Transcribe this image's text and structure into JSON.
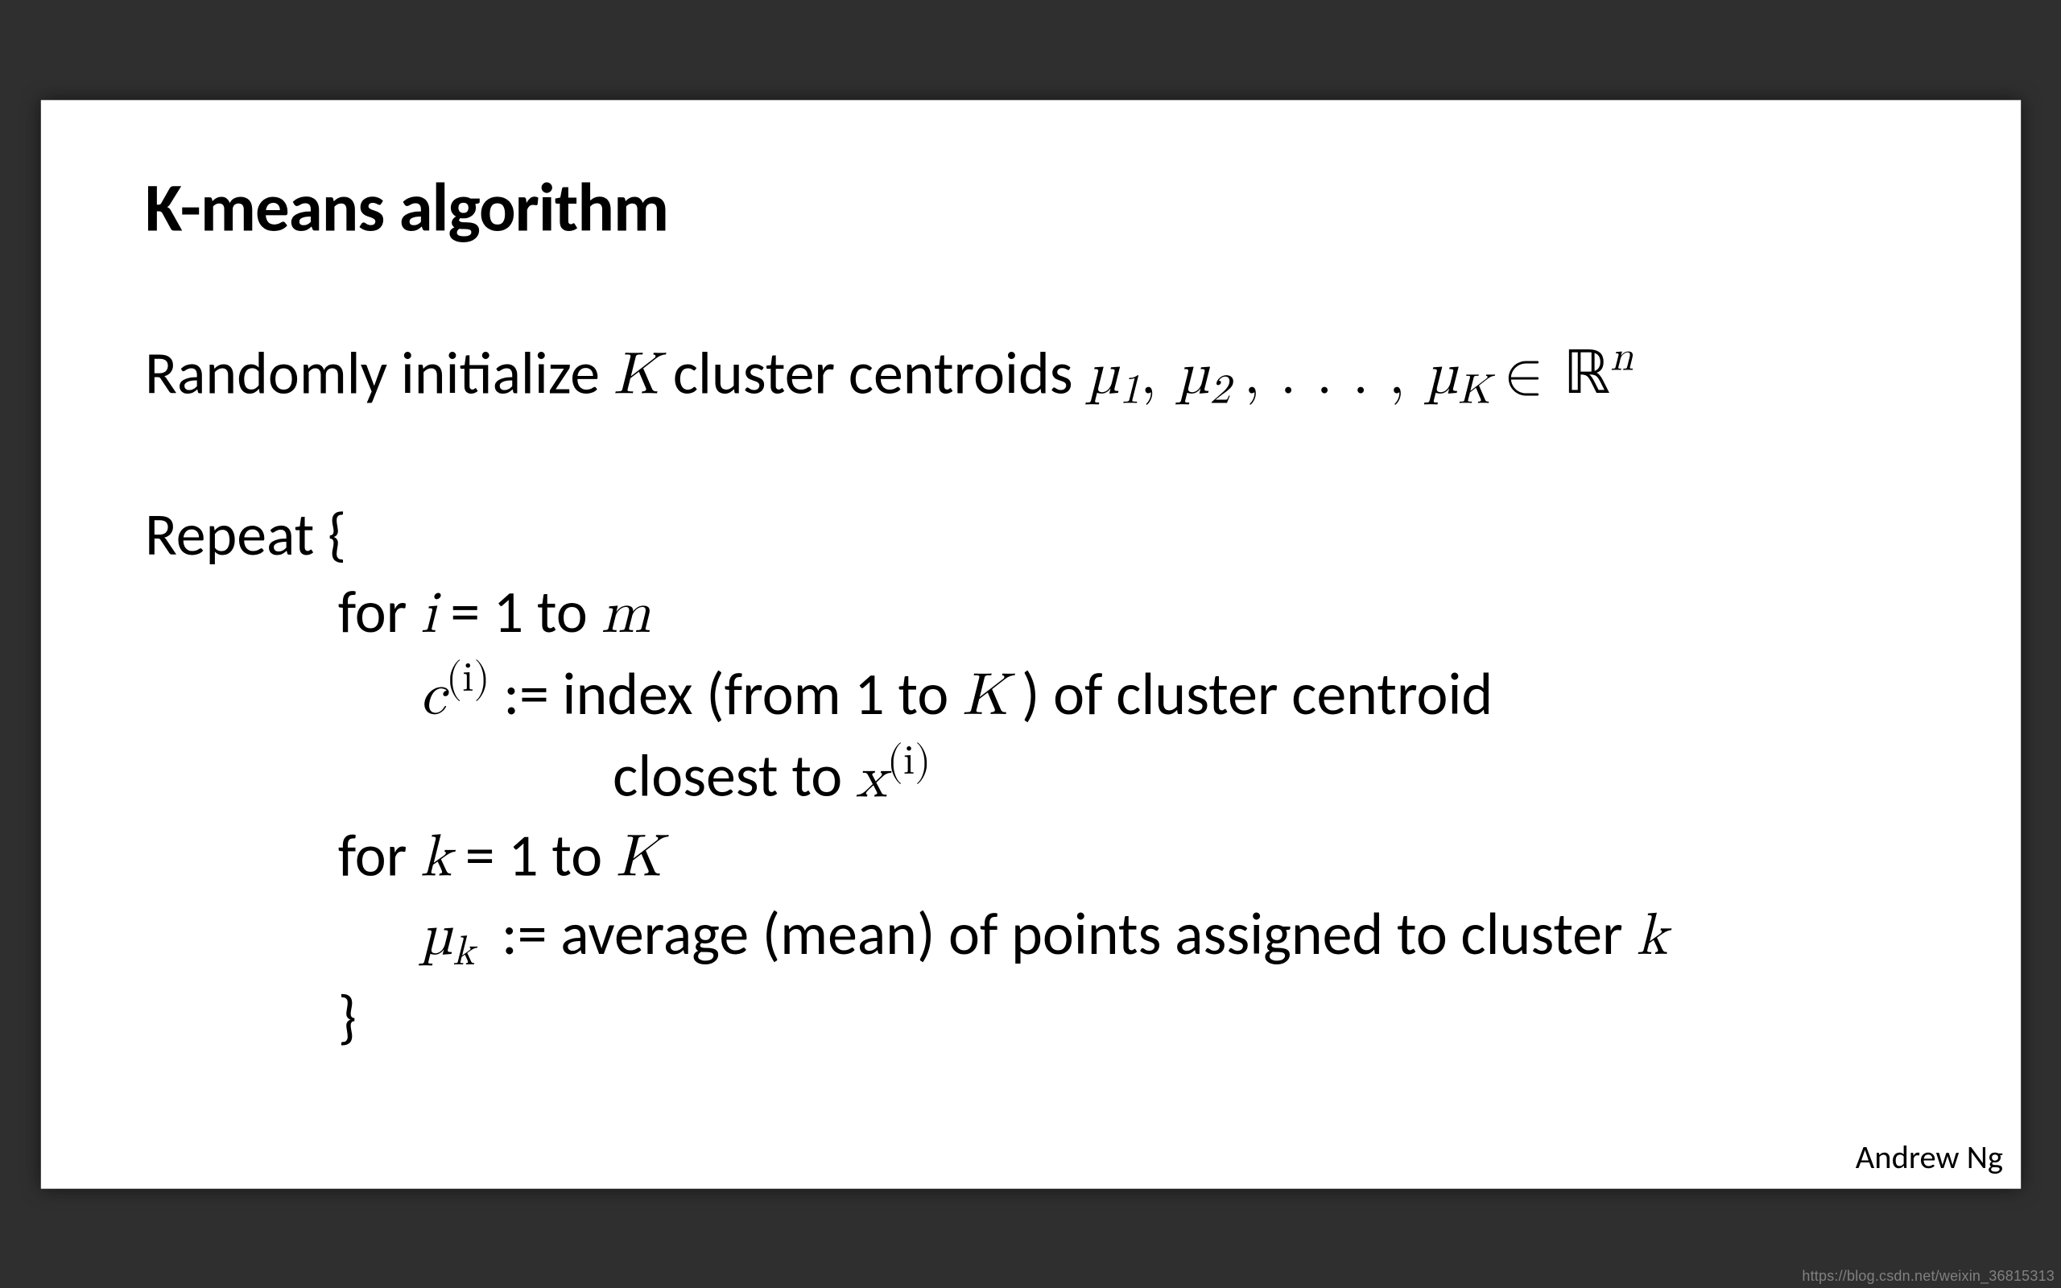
{
  "slide": {
    "title": "K-means algorithm",
    "line_init_prefix": "Randomly initialize ",
    "line_init_mid": " cluster centroids ",
    "sym_K": "K",
    "sym_mu": "µ",
    "sym_dots": ", . . . , ",
    "sym_in": " ∈ ",
    "sym_Rn_R": "ℝ",
    "sym_Rn_n": "n",
    "repeat_open": "Repeat {",
    "for_word": "for ",
    "eq_1_to": " = 1 to ",
    "sym_i": "i",
    "sym_m": "m",
    "sym_c": "c",
    "sup_i": "(i)",
    "assign": " := ",
    "index_from_1_to": "index (from 1 to ",
    "of_cluster_centroid": " ) of cluster centroid",
    "closest_to": "closest to ",
    "sym_x": "x",
    "sym_k": "k",
    "avg_line": "average (mean) of points assigned to cluster ",
    "close_brace": "}",
    "attribution": "Andrew Ng"
  },
  "watermark": "https://blog.csdn.net/weixin_36815313"
}
